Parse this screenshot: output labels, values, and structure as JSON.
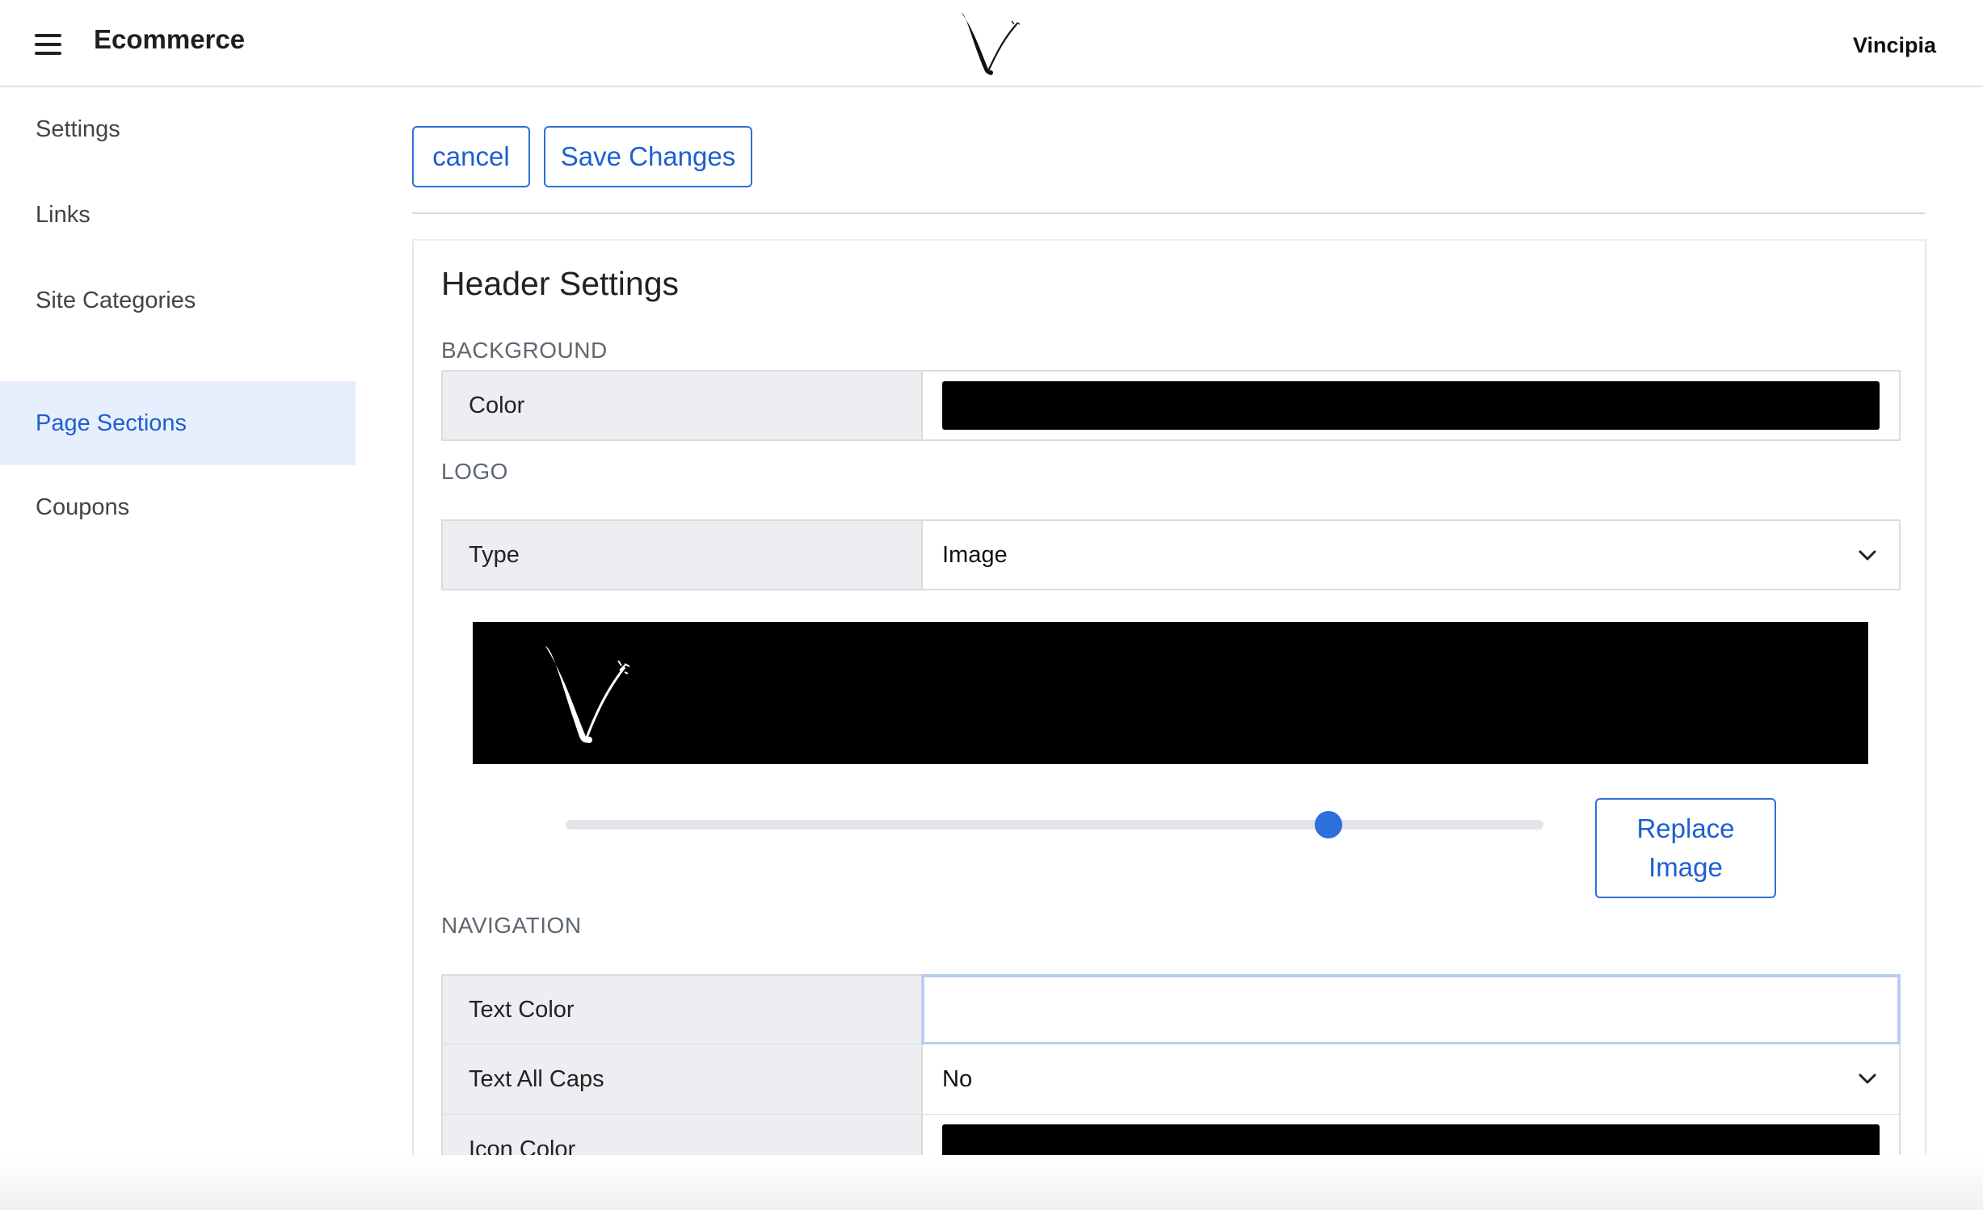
{
  "topbar": {
    "app_title": "Ecommerce",
    "user_name": "Vincipia",
    "logo_icon": "script-v-logo-icon"
  },
  "sidebar": {
    "items": [
      {
        "label": "Settings",
        "active": false
      },
      {
        "label": "Links",
        "active": false
      },
      {
        "label": "Site Categories",
        "active": false
      },
      {
        "label": "Page Sections",
        "active": true
      },
      {
        "label": "Coupons",
        "active": false
      }
    ]
  },
  "toolbar": {
    "cancel_label": "cancel",
    "save_label": "Save Changes"
  },
  "header_settings": {
    "title": "Header Settings",
    "background": {
      "section_label": "BACKGROUND",
      "color_label": "Color",
      "color_value": "#000000"
    },
    "logo": {
      "section_label": "LOGO",
      "type_label": "Type",
      "type_value": "Image",
      "size_slider_fraction": 0.78,
      "replace_label_line1": "Replace",
      "replace_label_line2": "Image"
    },
    "navigation": {
      "section_label": "NAVIGATION",
      "text_color_label": "Text Color",
      "text_color_value": "",
      "text_all_caps_label": "Text All Caps",
      "text_all_caps_value": "No",
      "icon_color_label": "Icon Color",
      "icon_color_value": "#000000"
    }
  },
  "colors": {
    "accent": "#2d6fdb",
    "active_nav_bg": "#e8effc",
    "label_cell_bg": "#eceef1"
  }
}
